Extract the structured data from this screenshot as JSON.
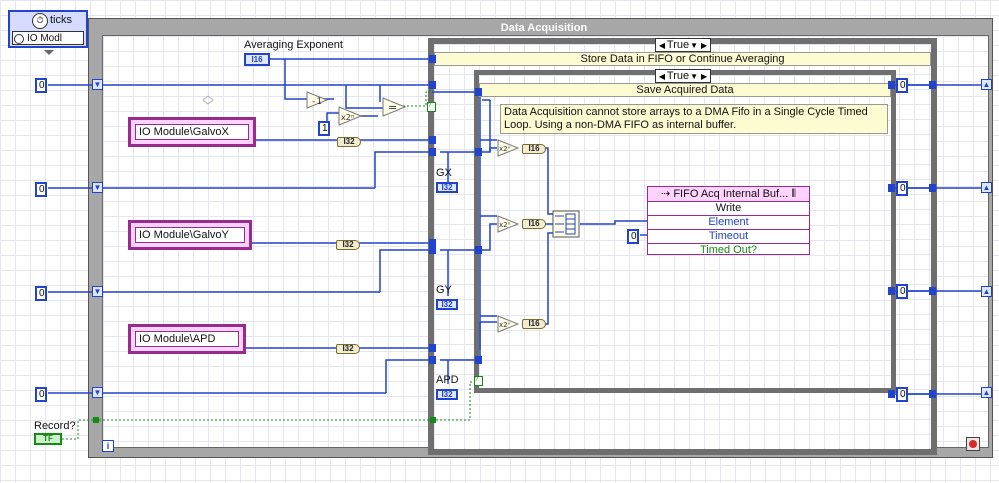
{
  "input_node": {
    "label": "ticks",
    "module": "IO Modl"
  },
  "loop": {
    "title": "Data Acquisition",
    "iteration_terminal": "i"
  },
  "outer_case": {
    "selector": "True",
    "comment": "Store Data in FIFO or Continue Averaging"
  },
  "inner_case": {
    "selector": "True",
    "title": "Save Acquired Data",
    "comment": "Data Acquisition cannot store arrays to a DMA Fifo in a Single Cycle Timed Loop. Using a non-DMA FIFO as internal buffer."
  },
  "averaging_exponent": {
    "label": "Averaging Exponent",
    "type": "I16"
  },
  "io_nodes": [
    {
      "name": "IO Module\\GalvoX"
    },
    {
      "name": "IO Module\\GalvoY"
    },
    {
      "name": "IO Module\\APD"
    }
  ],
  "indicators": [
    {
      "label": "GX",
      "type": "I32"
    },
    {
      "label": "GY",
      "type": "I32"
    },
    {
      "label": "APD",
      "type": "I32"
    }
  ],
  "constants": {
    "shift_zero": "0",
    "one": "1",
    "timeout_zero": "0"
  },
  "coercions": {
    "i32": "I32",
    "i16": "I16"
  },
  "fifo": {
    "title": "FIFO Acq Internal Buf...",
    "mode": "Write",
    "element": "Element",
    "timeout": "Timeout",
    "timed_out": "Timed Out?"
  },
  "record": {
    "label": "Record?",
    "value": "TF"
  },
  "colors": {
    "wire_int": "#2244cc",
    "wire_bool": "#148c14",
    "io": "#9a2a8e"
  }
}
